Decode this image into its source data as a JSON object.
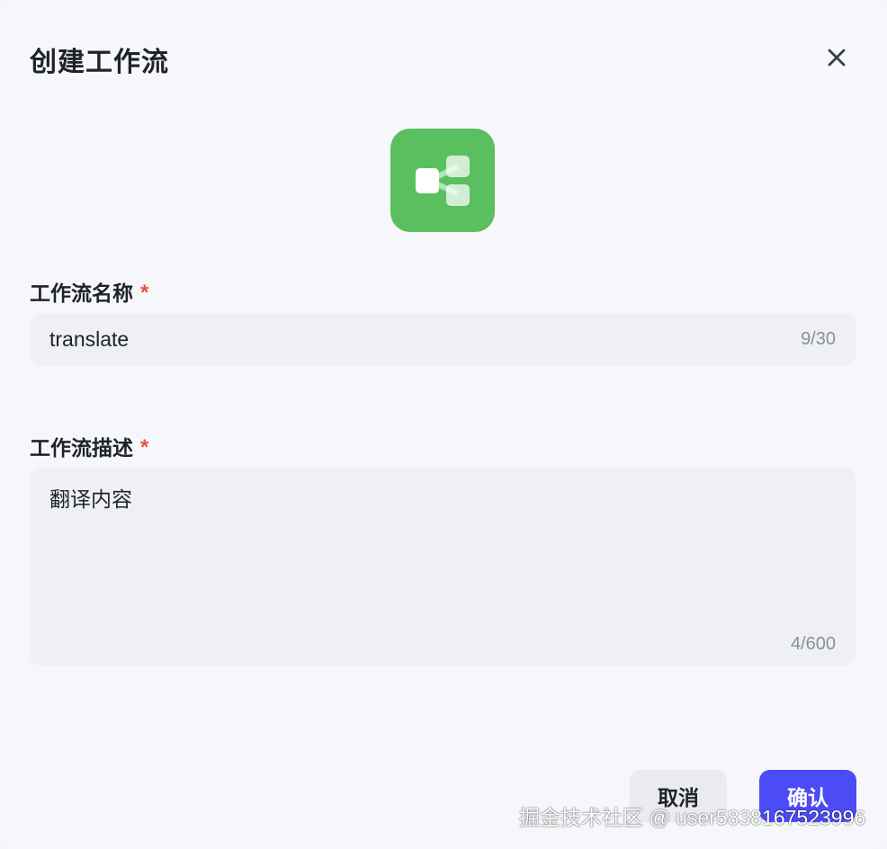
{
  "dialog": {
    "title": "创建工作流",
    "close_icon": "close-icon"
  },
  "workflow_icon": {
    "icon": "workflow-share-icon",
    "background_color": "#5ac05f"
  },
  "name_field": {
    "label": "工作流名称",
    "required_mark": "*",
    "value": "translate",
    "counter": "9/30"
  },
  "description_field": {
    "label": "工作流描述",
    "required_mark": "*",
    "value": "翻译内容",
    "counter": "4/600"
  },
  "footer": {
    "cancel_label": "取消",
    "confirm_label": "确认"
  },
  "watermark": {
    "text": "掘金技术社区 @ user5838167523996"
  },
  "colors": {
    "accent": "#4b4cf5",
    "required": "#e5533f",
    "icon_green": "#5ac05f"
  }
}
